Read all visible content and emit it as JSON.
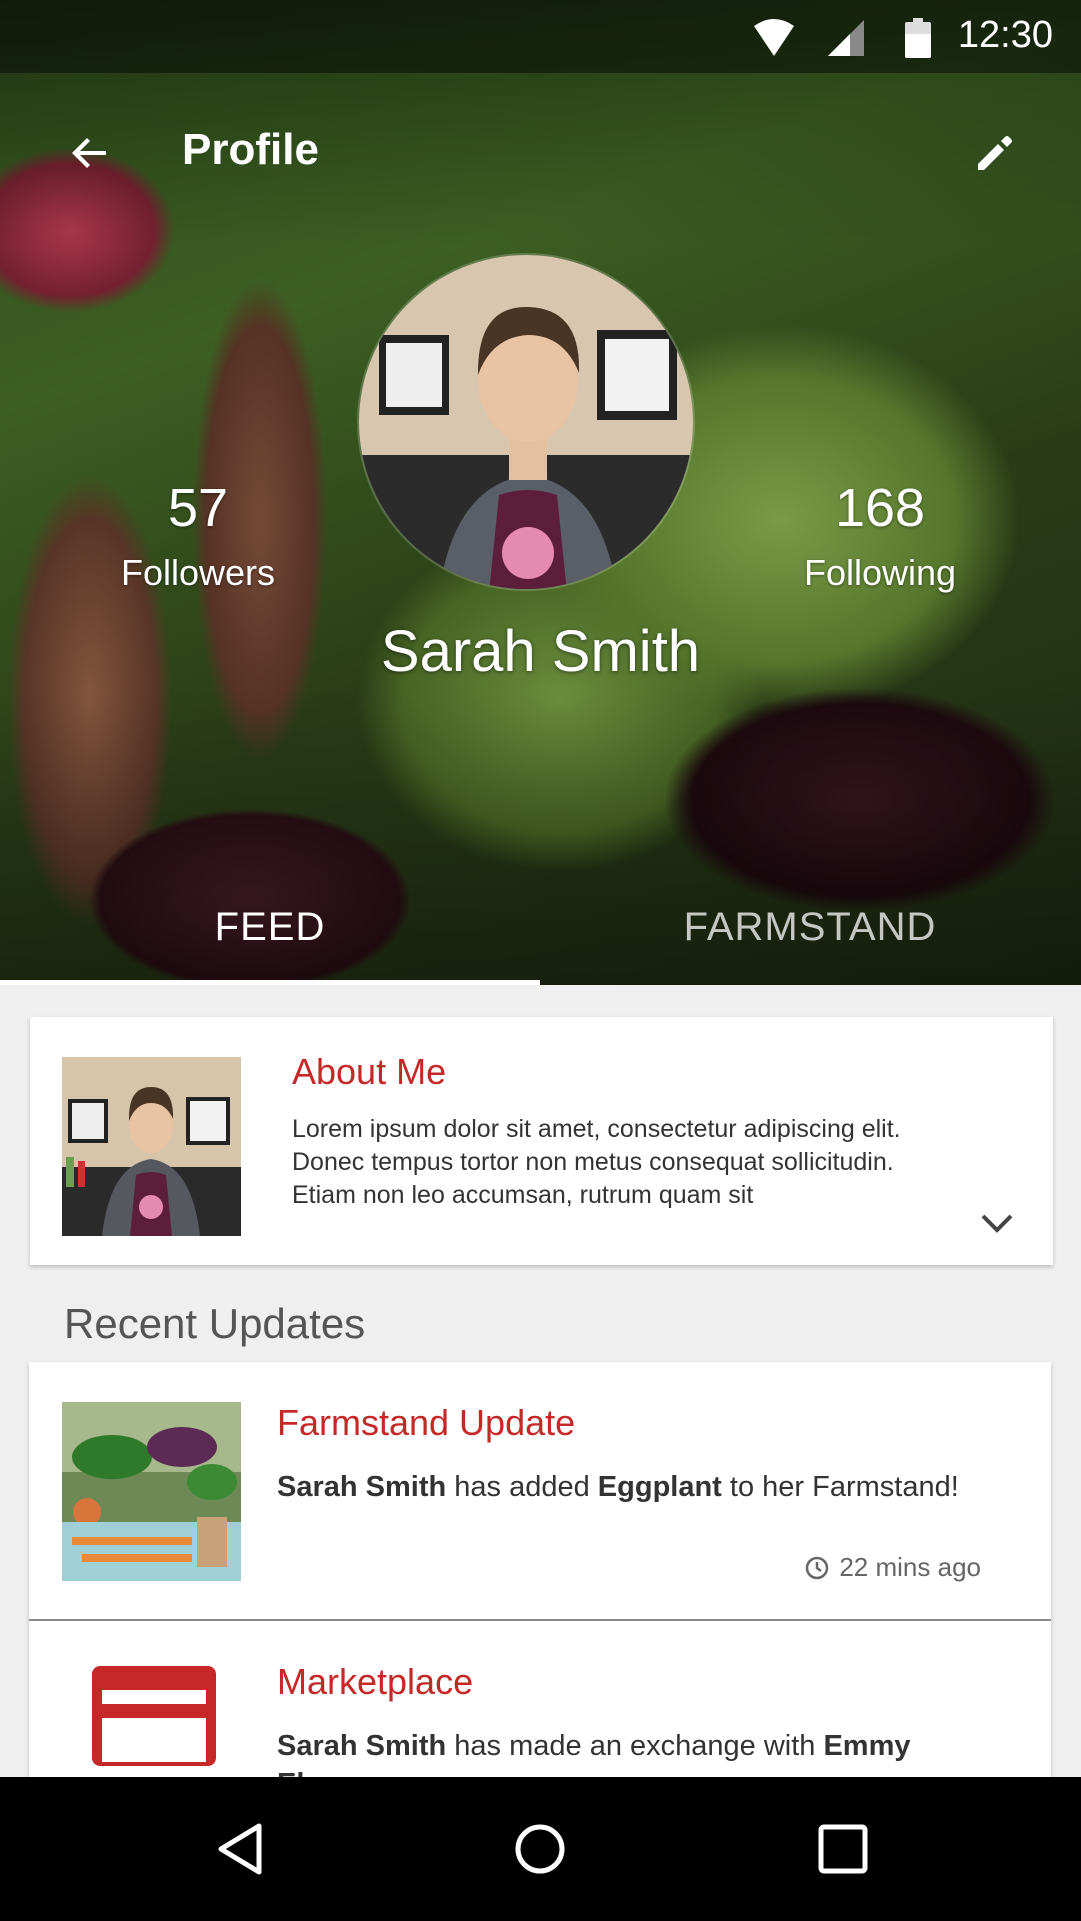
{
  "status_bar": {
    "time": "12:30",
    "icons": [
      "wifi-icon",
      "signal-icon",
      "battery-icon"
    ]
  },
  "app_bar": {
    "title": "Profile",
    "back_icon": "arrow-back-icon",
    "edit_icon": "pencil-edit-icon"
  },
  "profile": {
    "name": "Sarah Smith",
    "followers": {
      "count": "57",
      "label": "Followers"
    },
    "following": {
      "count": "168",
      "label": "Following"
    }
  },
  "tabs": [
    {
      "label": "FEED",
      "selected": true
    },
    {
      "label": "FARMSTAND",
      "selected": false
    }
  ],
  "about": {
    "title": "About Me",
    "text": "Lorem ipsum dolor sit amet, consectetur adipiscing elit. Donec tempus tortor non metus consequat sollicitudin. Etiam non leo accumsan, rutrum quam sit",
    "expand_icon": "chevron-down-icon"
  },
  "recent_updates": {
    "title": "Recent Updates",
    "items": [
      {
        "title": "Farmstand Update",
        "actor": "Sarah Smith",
        "mid": " has added ",
        "object": "Eggplant",
        "tail": " to her Farmstand!",
        "time": "22 mins ago"
      },
      {
        "title": "Marketplace",
        "actor": "Sarah Smith",
        "mid": " has made an exchange with ",
        "object": "Emmy Elnora",
        "tail": ""
      }
    ]
  },
  "colors": {
    "accent": "#c62828",
    "nav_bar": "#000000",
    "background": "#efefef"
  }
}
